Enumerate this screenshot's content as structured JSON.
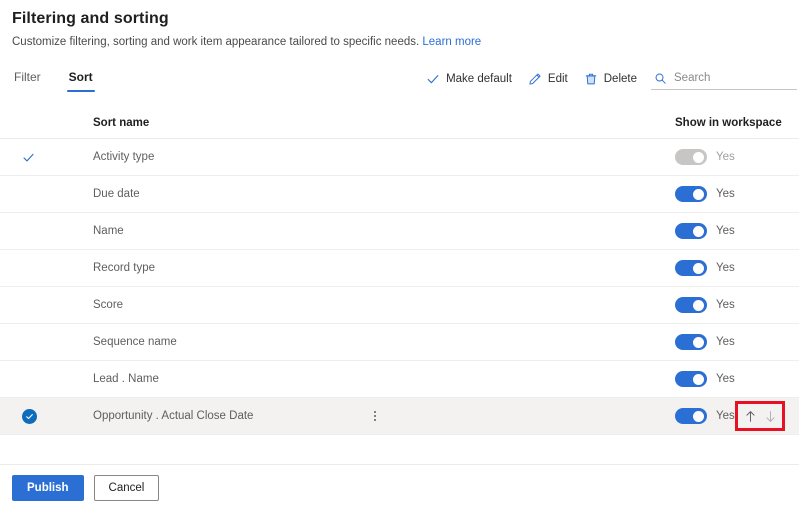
{
  "header": {
    "title": "Filtering and sorting",
    "subtitle": "Customize filtering, sorting and work item appearance tailored to specific needs.",
    "learn_more": "Learn more"
  },
  "tabs": [
    {
      "label": "Filter",
      "active": false
    },
    {
      "label": "Sort",
      "active": true
    }
  ],
  "toolbar": {
    "make_default_label": "Make default",
    "make_default_icon": "checkmark-icon",
    "edit_label": "Edit",
    "edit_icon": "pencil-icon",
    "delete_label": "Delete",
    "delete_icon": "trash-icon",
    "search_placeholder": "Search",
    "search_value": "",
    "search_icon": "search-icon"
  },
  "table": {
    "columns": {
      "sort_name": "Sort name",
      "show_in_workspace": "Show in workspace"
    },
    "rows": [
      {
        "name": "Activity type",
        "is_default": true,
        "selected": false,
        "toggle_on": false,
        "toggle_disabled": true,
        "toggle_label": "Yes",
        "has_more_menu": false
      },
      {
        "name": "Due date",
        "is_default": false,
        "selected": false,
        "toggle_on": true,
        "toggle_disabled": false,
        "toggle_label": "Yes",
        "has_more_menu": false
      },
      {
        "name": "Name",
        "is_default": false,
        "selected": false,
        "toggle_on": true,
        "toggle_disabled": false,
        "toggle_label": "Yes",
        "has_more_menu": false
      },
      {
        "name": "Record type",
        "is_default": false,
        "selected": false,
        "toggle_on": true,
        "toggle_disabled": false,
        "toggle_label": "Yes",
        "has_more_menu": false
      },
      {
        "name": "Score",
        "is_default": false,
        "selected": false,
        "toggle_on": true,
        "toggle_disabled": false,
        "toggle_label": "Yes",
        "has_more_menu": false
      },
      {
        "name": "Sequence name",
        "is_default": false,
        "selected": false,
        "toggle_on": true,
        "toggle_disabled": false,
        "toggle_label": "Yes",
        "has_more_menu": false
      },
      {
        "name": "Lead . Name",
        "is_default": false,
        "selected": false,
        "toggle_on": true,
        "toggle_disabled": false,
        "toggle_label": "Yes",
        "has_more_menu": false
      },
      {
        "name": "Opportunity . Actual Close Date",
        "is_default": false,
        "selected": true,
        "toggle_on": true,
        "toggle_disabled": false,
        "toggle_label": "Yes",
        "has_more_menu": true
      }
    ]
  },
  "reorder": {
    "move_up_icon": "arrow-up-icon",
    "move_down_icon": "arrow-down-icon",
    "annotation_color": "#e81123"
  },
  "footer": {
    "publish_label": "Publish",
    "cancel_label": "Cancel"
  },
  "colors": {
    "accent": "#2b6fd4",
    "selected_row": "#f3f2f1",
    "checkbox_blue": "#0f6cbd",
    "annotation_red": "#e81123"
  }
}
